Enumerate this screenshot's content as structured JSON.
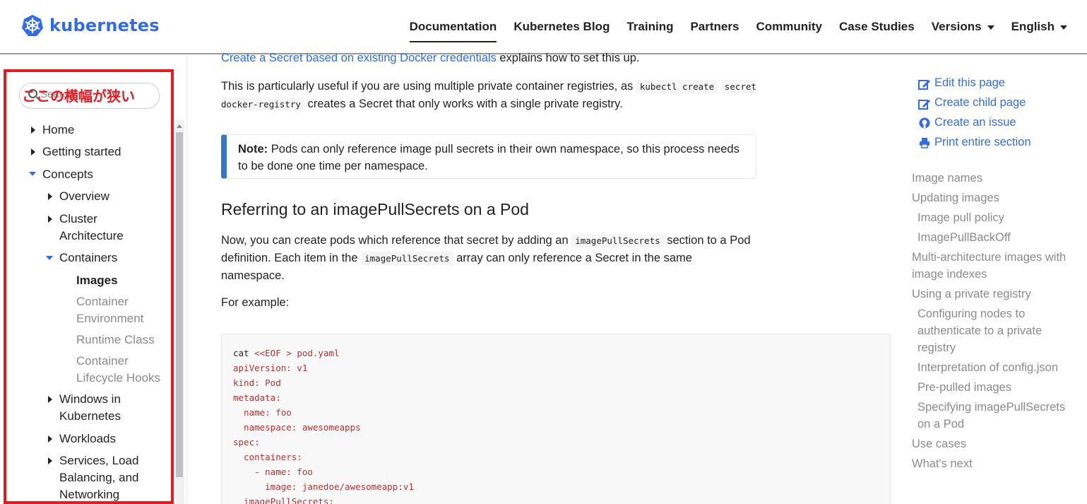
{
  "header": {
    "logo_text": "kubernetes",
    "nav": [
      "Documentation",
      "Kubernetes Blog",
      "Training",
      "Partners",
      "Community",
      "Case Studies",
      "Versions",
      "English"
    ]
  },
  "sidebar": {
    "search_placeholder": "Search",
    "annotation": "ここの横幅が狭い",
    "items": {
      "home": "Home",
      "getting_started": "Getting started",
      "concepts": "Concepts",
      "overview": "Overview",
      "cluster_1": "Cluster",
      "cluster_2": "Architecture",
      "containers": "Containers",
      "images": "Images",
      "container_env_1": "Container",
      "container_env_2": "Environment",
      "runtime_class": "Runtime Class",
      "lifecycle_1": "Container",
      "lifecycle_2": "Lifecycle Hooks",
      "windows_1": "Windows in",
      "windows_2": "Kubernetes",
      "workloads": "Workloads",
      "services_1": "Services, Load",
      "services_2": "Balancing, and",
      "services_3": "Networking"
    }
  },
  "main": {
    "top_link": "Create a Secret based on existing Docker credentials",
    "top_rest": " explains how to set this up.",
    "p1_a": "This is particularly useful if you are using multiple private container registries, as ",
    "p1_code1": "kubectl create",
    "p1_code2": "secret docker-registry",
    "p1_b": " creates a Secret that only works with a single private registry.",
    "note_label": "Note:",
    "note_text": " Pods can only reference image pull secrets in their own namespace, so this process needs to be done one time per namespace.",
    "heading": "Referring to an imagePullSecrets on a Pod",
    "p2_a": "Now, you can create pods which reference that secret by adding an ",
    "p2_code1": "imagePullSecrets",
    "p2_b": " section to a Pod definition. Each item in the ",
    "p2_code2": "imagePullSecrets",
    "p2_c": " array can only reference a Secret in the same namespace.",
    "p3": "For example:",
    "code_first_black": "cat ",
    "code_first_rest": "<<EOF > pod.yaml",
    "code_lines": [
      "apiVersion: v1",
      "kind: Pod",
      "metadata:",
      "  name: foo",
      "  namespace: awesomeapps",
      "spec:",
      "  containers:",
      "    - name: foo",
      "      image: janedoe/awesomeapp:v1",
      "  imagePullSecrets:"
    ]
  },
  "toc": {
    "actions": [
      "Edit this page",
      "Create child page",
      "Create an issue",
      "Print entire section"
    ],
    "items": [
      "Image names",
      "Updating images",
      "Image pull policy",
      "ImagePullBackOff",
      "Multi-architecture images with",
      "image indexes",
      "Using a private registry",
      "Configuring nodes to",
      "authenticate to a private",
      "registry",
      "Interpretation of config.json",
      "Pre-pulled images",
      "Specifying imagePullSecrets",
      "on a Pod",
      "Use cases",
      "What's next"
    ]
  },
  "colors": {
    "brand": "#326ce5",
    "annotation": "#e41b23",
    "note_bar": "#3578c6"
  }
}
